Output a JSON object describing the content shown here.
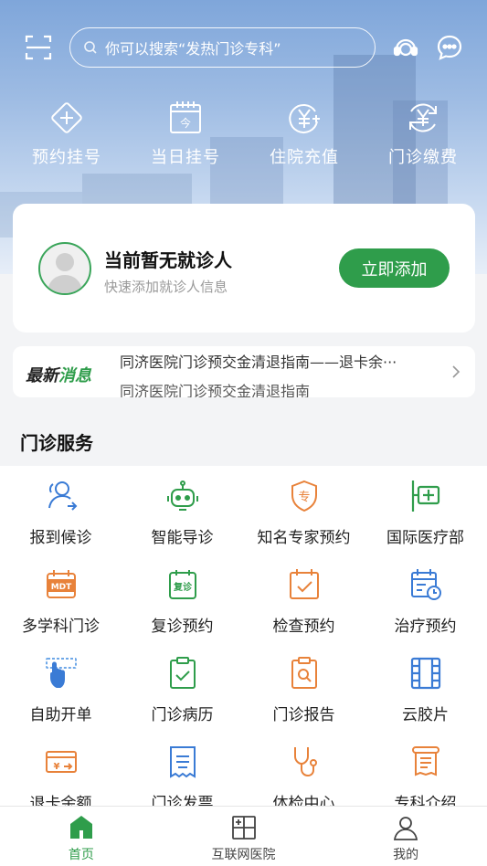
{
  "header": {
    "search_placeholder": "你可以搜索“发热门诊专科”"
  },
  "quick_actions": [
    {
      "label": "预约挂号",
      "icon": "plus-diamond-icon"
    },
    {
      "label": "当日挂号",
      "icon": "calendar-today-icon"
    },
    {
      "label": "住院充值",
      "icon": "yen-plus-icon"
    },
    {
      "label": "门诊缴费",
      "icon": "yen-refresh-icon"
    }
  ],
  "patient_card": {
    "title": "当前暂无就诊人",
    "subtitle": "快速添加就诊人信息",
    "add_button": "立即添加"
  },
  "news": {
    "logo_part1": "最新",
    "logo_part2": "消息",
    "headline": "同济医院门诊预交金清退指南——退卡余···",
    "headline2": "同济医院门诊预交金清退指南"
  },
  "section": {
    "title": "门诊服务"
  },
  "services": [
    {
      "label": "报到候诊",
      "icon": "checkin-user-icon",
      "color": "#3a7bd5"
    },
    {
      "label": "智能导诊",
      "icon": "robot-icon",
      "color": "#2f9d4b"
    },
    {
      "label": "知名专家预约",
      "icon": "expert-shield-icon",
      "color": "#e8823a"
    },
    {
      "label": "国际医疗部",
      "icon": "international-clinic-icon",
      "color": "#2f9d4b"
    },
    {
      "label": "多学科门诊",
      "icon": "mdt-calendar-icon",
      "color": "#e8823a"
    },
    {
      "label": "复诊预约",
      "icon": "revisit-icon",
      "color": "#2f9d4b"
    },
    {
      "label": "检查预约",
      "icon": "check-calendar-icon",
      "color": "#e8823a"
    },
    {
      "label": "治疗预约",
      "icon": "treatment-calendar-icon",
      "color": "#3a7bd5"
    },
    {
      "label": "自助开单",
      "icon": "touch-hand-icon",
      "color": "#3a7bd5"
    },
    {
      "label": "门诊病历",
      "icon": "clipboard-check-icon",
      "color": "#2f9d4b"
    },
    {
      "label": "门诊报告",
      "icon": "report-search-icon",
      "color": "#e8823a"
    },
    {
      "label": "云胶片",
      "icon": "film-icon",
      "color": "#3a7bd5"
    },
    {
      "label": "退卡余额",
      "icon": "refund-card-icon",
      "color": "#e8823a"
    },
    {
      "label": "门诊发票",
      "icon": "invoice-icon",
      "color": "#3a7bd5"
    },
    {
      "label": "体检中心",
      "icon": "stethoscope-icon",
      "color": "#e8823a"
    },
    {
      "label": "专科介绍",
      "icon": "scroll-icon",
      "color": "#e8823a"
    }
  ],
  "tabbar": [
    {
      "label": "首页",
      "icon": "home-icon",
      "active": true
    },
    {
      "label": "互联网医院",
      "icon": "internet-hospital-icon",
      "active": false
    },
    {
      "label": "我的",
      "icon": "user-icon",
      "active": false
    }
  ],
  "colors": {
    "accent": "#2f9d4b",
    "blue": "#3a7bd5",
    "orange": "#e8823a"
  }
}
